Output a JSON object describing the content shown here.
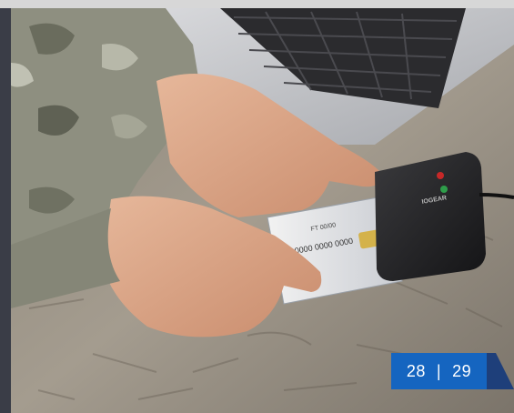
{
  "photo": {
    "description_icon": "photo-icon",
    "reader_brand": "IOGEAR",
    "card_number_line": "00 0000 0000 0000",
    "card_small_line": "FT 00/00"
  },
  "pagination": {
    "left_page": "28",
    "separator": "|",
    "right_page": "29"
  },
  "colors": {
    "tab_blue": "#1565c0",
    "side_bar": "#3a3d47"
  }
}
